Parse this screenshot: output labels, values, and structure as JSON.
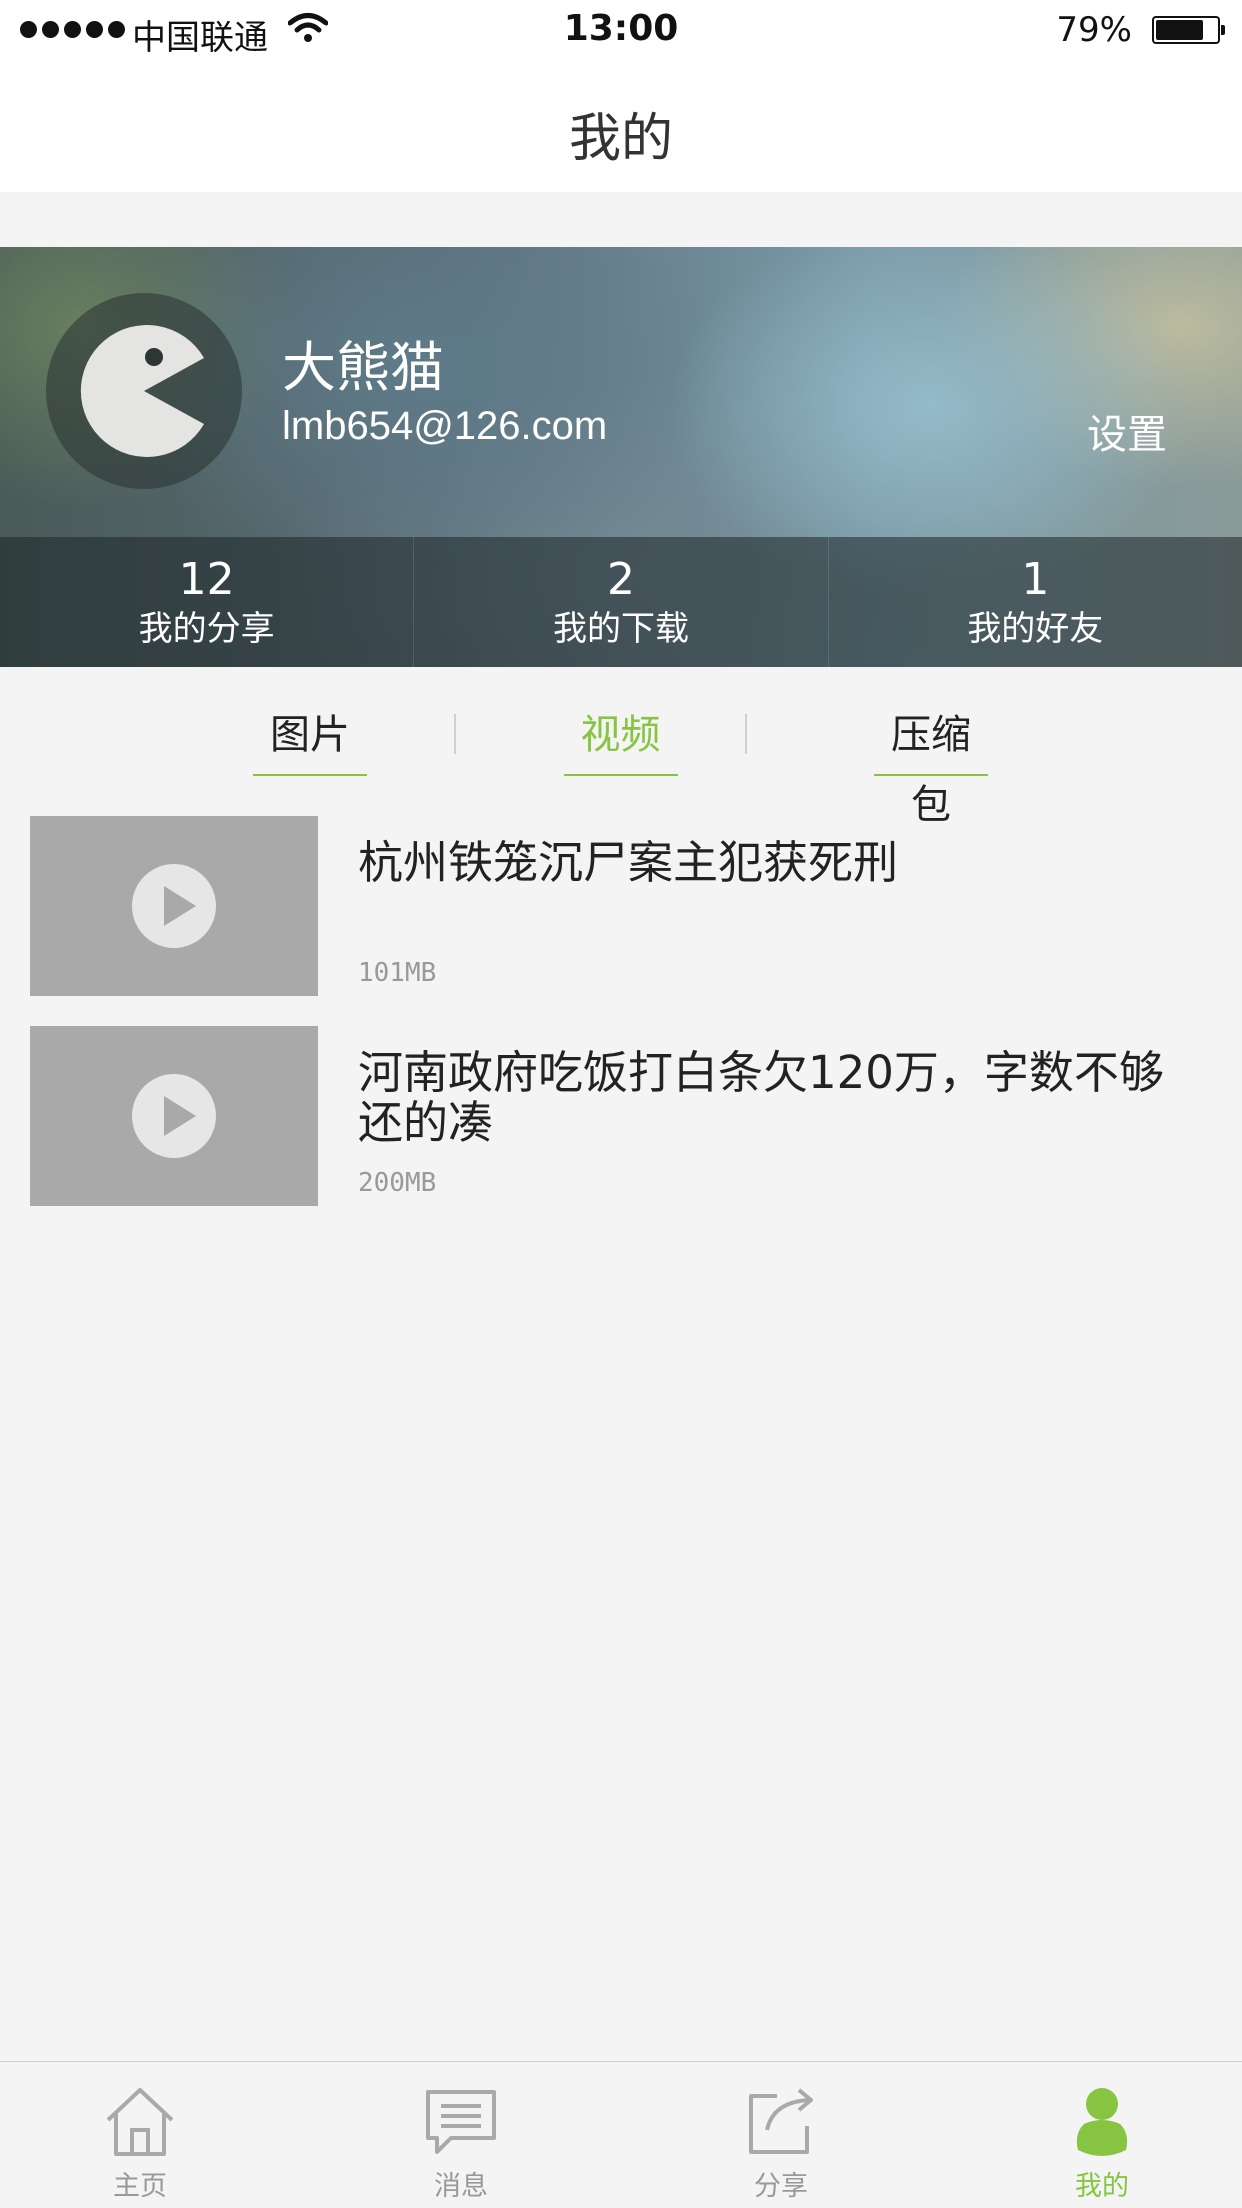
{
  "status_bar": {
    "carrier": "中国联通",
    "time": "13:00",
    "battery_percent": "79%",
    "battery_level": 0.79,
    "signal_bars": 5,
    "wifi_icon": "wifi-icon"
  },
  "nav_bar": {
    "title": "我的"
  },
  "profile": {
    "username": "大熊猫",
    "email": "lmb654@126.com",
    "settings_label": "设置",
    "avatar_icon": "pacman-avatar-icon",
    "stats": [
      {
        "count": "12",
        "label": "我的分享"
      },
      {
        "count": "2",
        "label": "我的下载"
      },
      {
        "count": "1",
        "label": "我的好友"
      }
    ]
  },
  "tabs": {
    "items": [
      "图片",
      "视频",
      "压缩包"
    ],
    "active_index": 1
  },
  "videos": [
    {
      "title": "杭州铁笼沉尸案主犯获死刑",
      "size": "101MB",
      "icon": "play-icon"
    },
    {
      "title": "河南政府吃饭打白条欠120万，字数不够还的凑",
      "size": "200MB",
      "icon": "play-icon"
    }
  ],
  "tabbar": {
    "items": [
      {
        "label": "主页",
        "icon": "home-icon"
      },
      {
        "label": "消息",
        "icon": "message-icon"
      },
      {
        "label": "分享",
        "icon": "share-icon"
      },
      {
        "label": "我的",
        "icon": "profile-icon"
      }
    ],
    "active_index": 3
  },
  "colors": {
    "accent": "#86c442",
    "inactive": "#999999",
    "background": "#f4f4f4",
    "thumbnail": "#a9a9a9"
  }
}
